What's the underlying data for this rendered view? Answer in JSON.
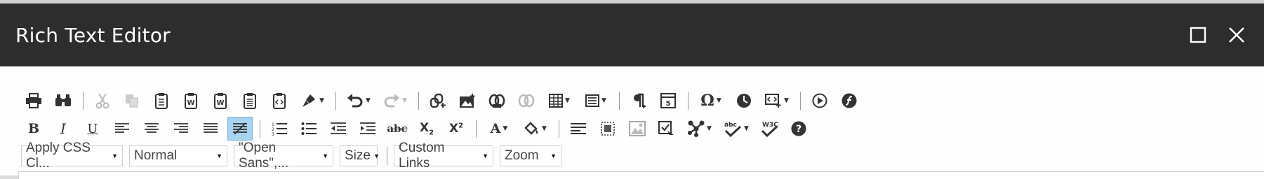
{
  "window": {
    "title": "Rich Text Editor",
    "maximize_icon": "maximize-icon",
    "close_icon": "close-icon"
  },
  "toolbar_row1": [
    {
      "name": "print-button",
      "icon": "printer-icon",
      "glyph": "🖶"
    },
    {
      "name": "find-button",
      "icon": "binoculars-icon",
      "glyph": "⌕"
    },
    {
      "name": "cut-button",
      "icon": "scissors-icon",
      "glyph": "✂",
      "disabled": true
    },
    {
      "name": "copy-button",
      "icon": "copy-icon",
      "glyph": "❐",
      "disabled": true
    },
    {
      "name": "paste-button",
      "icon": "clipboard-icon",
      "glyph": "📋"
    },
    {
      "name": "paste-word-button",
      "icon": "clipboard-word-icon",
      "glyph": "W"
    },
    {
      "name": "paste-word-2-button",
      "icon": "clipboard-word-icon",
      "glyph": "W"
    },
    {
      "name": "paste-text-button",
      "icon": "clipboard-text-icon",
      "glyph": "▤"
    },
    {
      "name": "paste-html-button",
      "icon": "clipboard-html-icon",
      "glyph": "⟨⟩"
    },
    {
      "name": "format-painter-button",
      "icon": "paintbrush-icon",
      "glyph": "🖌"
    },
    {
      "name": "undo-button",
      "icon": "undo-icon",
      "glyph": "↶"
    },
    {
      "name": "redo-button",
      "icon": "redo-icon",
      "glyph": "↷",
      "disabled": true
    },
    {
      "name": "insert-link-button",
      "icon": "link-icon",
      "glyph": "🔗"
    },
    {
      "name": "insert-image-button",
      "icon": "image-icon",
      "glyph": "🖼"
    },
    {
      "name": "hyperlink-manager-button",
      "icon": "chain-icon",
      "glyph": "⛓"
    },
    {
      "name": "remove-link-button",
      "icon": "unlink-icon",
      "glyph": "⛓",
      "disabled": true
    },
    {
      "name": "insert-table-button",
      "icon": "table-icon",
      "glyph": "▦"
    },
    {
      "name": "table-properties-button",
      "icon": "table-properties-icon",
      "glyph": "▥"
    },
    {
      "name": "show-paragraphs-button",
      "icon": "pilcrow-icon",
      "glyph": "¶"
    },
    {
      "name": "template-button",
      "icon": "template-icon",
      "glyph": "▣"
    },
    {
      "name": "special-character-button",
      "icon": "omega-icon",
      "glyph": "Ω"
    },
    {
      "name": "insert-time-button",
      "icon": "clock-icon",
      "glyph": "◷"
    },
    {
      "name": "insert-snippet-button",
      "icon": "snippet-icon",
      "glyph": "⊡"
    },
    {
      "name": "media-button",
      "icon": "play-icon",
      "glyph": "▶"
    },
    {
      "name": "flash-button",
      "icon": "flash-icon",
      "glyph": "ƒ"
    }
  ],
  "toolbar_row2": [
    {
      "name": "bold-button",
      "icon": "bold-icon",
      "glyph": "B"
    },
    {
      "name": "italic-button",
      "icon": "italic-icon",
      "glyph": "I"
    },
    {
      "name": "underline-button",
      "icon": "underline-icon",
      "glyph": "U"
    },
    {
      "name": "align-left-button",
      "icon": "align-left-icon",
      "glyph": "≡"
    },
    {
      "name": "align-center-button",
      "icon": "align-center-icon",
      "glyph": "≡"
    },
    {
      "name": "align-right-button",
      "icon": "align-right-icon",
      "glyph": "≡"
    },
    {
      "name": "justify-button",
      "icon": "justify-icon",
      "glyph": "≣"
    },
    {
      "name": "remove-alignment-button",
      "icon": "remove-alignment-icon",
      "glyph": "⍁",
      "active": true
    },
    {
      "name": "numbered-list-button",
      "icon": "numbered-list-icon",
      "glyph": "⒈"
    },
    {
      "name": "bulleted-list-button",
      "icon": "bulleted-list-icon",
      "glyph": "•"
    },
    {
      "name": "outdent-button",
      "icon": "outdent-icon",
      "glyph": "⇤"
    },
    {
      "name": "indent-button",
      "icon": "indent-icon",
      "glyph": "⇥"
    },
    {
      "name": "strikethrough-button",
      "icon": "strikethrough-icon",
      "glyph": "abc"
    },
    {
      "name": "subscript-button",
      "icon": "subscript-icon",
      "glyph": "X₂"
    },
    {
      "name": "superscript-button",
      "icon": "superscript-icon",
      "glyph": "X²"
    },
    {
      "name": "font-color-button",
      "icon": "font-color-icon",
      "glyph": "A"
    },
    {
      "name": "highlight-color-button",
      "icon": "paint-bucket-icon",
      "glyph": "◈"
    },
    {
      "name": "paragraph-style-button",
      "icon": "paragraph-style-icon",
      "glyph": "≡"
    },
    {
      "name": "image-map-button",
      "icon": "image-map-icon",
      "glyph": "⊞"
    },
    {
      "name": "image-editor-button",
      "icon": "image-editor-icon",
      "glyph": "🖼",
      "disabled": true
    },
    {
      "name": "form-element-button",
      "icon": "form-checkbox-icon",
      "glyph": "☑"
    },
    {
      "name": "modules-button",
      "icon": "modules-icon",
      "glyph": "✣"
    },
    {
      "name": "spellcheck-button",
      "icon": "spellcheck-icon",
      "glyph": "✓"
    },
    {
      "name": "xhtml-validator-button",
      "icon": "w3c-validator-icon",
      "glyph": "✓"
    },
    {
      "name": "help-button",
      "icon": "help-icon",
      "glyph": "?"
    }
  ],
  "toolbar_row3": {
    "css_class": "Apply CSS Cl...",
    "paragraph": "Normal",
    "font_name": "\"Open Sans\",...",
    "font_size": "Size",
    "custom_links": "Custom Links",
    "zoom": "Zoom"
  }
}
